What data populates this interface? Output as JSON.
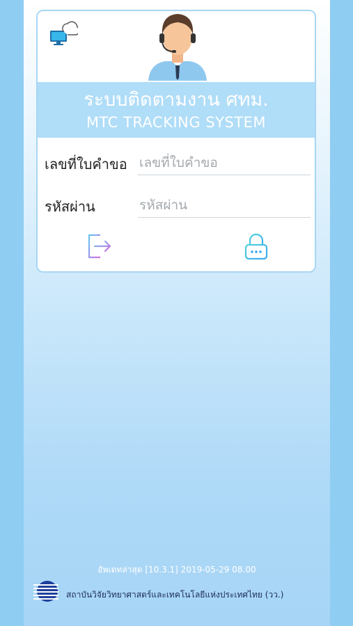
{
  "header": {
    "title_th": "ระบบติดตามงาน ศทม.",
    "title_en": "MTC TRACKING SYSTEM",
    "avatar_icon": "support-agent-avatar",
    "status_icon": "computer-cloud-icon"
  },
  "form": {
    "request_label": "เลขที่ใบคำขอ",
    "request_placeholder": "เลขที่ใบคำขอ",
    "password_label": "รหัสผ่าน",
    "password_placeholder": "รหัสผ่าน",
    "login_icon": "login-icon",
    "lock_icon": "lock-icon"
  },
  "footer": {
    "version": "อัพเดทล่าสุด [10.3.1] 2019-05-29 08.00",
    "organization": "สถาบันวิจัยวิทยาศาสตร์และเทคโนโลยีแห่งประเทศไทย  (วว.)"
  },
  "colors": {
    "banner": "#b0ddf8",
    "accent": "#2bb0e8",
    "background": "#8fcdf3"
  }
}
